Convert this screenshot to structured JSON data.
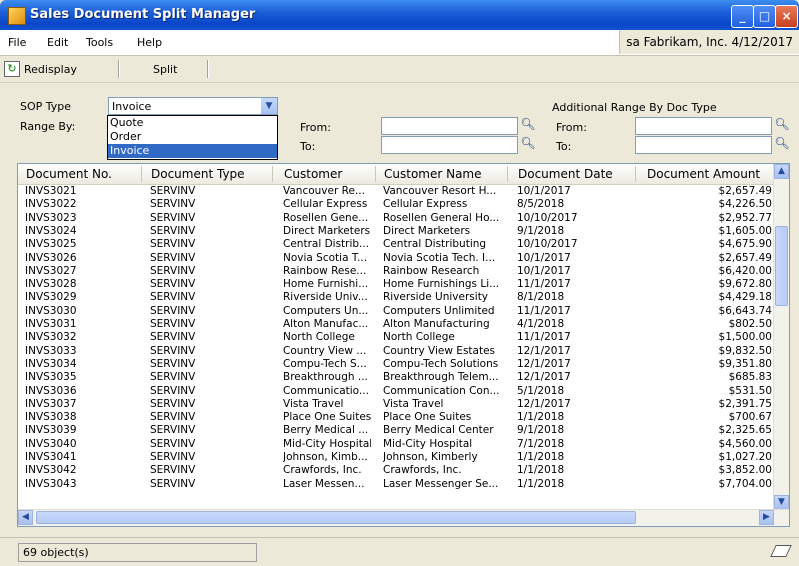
{
  "window": {
    "title": "Sales Document Split Manager"
  },
  "menu": {
    "items": [
      "File",
      "Edit",
      "Tools",
      "Help"
    ],
    "status": "sa  Fabrikam, Inc.  4/12/2017"
  },
  "toolbar": {
    "redisplay_label": "Redisplay",
    "split_label": "Split"
  },
  "filters": {
    "sop_type_label": "SOP Type",
    "sop_type_value": "Invoice",
    "range_by_label": "Range By:",
    "sop_options": [
      "Quote",
      "Order",
      "Invoice"
    ],
    "from_label": "From:",
    "to_label": "To:",
    "additional_label": "Additional Range By Doc Type",
    "from2_label": "From:",
    "to2_label": "To:"
  },
  "grid": {
    "columns": [
      "Document No.",
      "Document Type",
      "Customer",
      "Customer Name",
      "Document Date",
      "Document Amount"
    ],
    "rows": [
      [
        "INVS3021",
        "SERVINV",
        "Vancouver Re...",
        "Vancouver Resort H...",
        "10/1/2017",
        "$2,657.49"
      ],
      [
        "INVS3022",
        "SERVINV",
        "Cellular Express",
        "Cellular Express",
        "8/5/2018",
        "$4,226.50"
      ],
      [
        "INVS3023",
        "SERVINV",
        "Rosellen Gene...",
        "Rosellen General Ho...",
        "10/10/2017",
        "$2,952.77"
      ],
      [
        "INVS3024",
        "SERVINV",
        "Direct Marketers",
        "Direct Marketers",
        "9/1/2018",
        "$1,605.00"
      ],
      [
        "INVS3025",
        "SERVINV",
        "Central Distrib...",
        "Central Distributing",
        "10/10/2017",
        "$4,675.90"
      ],
      [
        "INVS3026",
        "SERVINV",
        "Novia Scotia T...",
        "Novia Scotia Tech. I...",
        "10/1/2017",
        "$2,657.49"
      ],
      [
        "INVS3027",
        "SERVINV",
        "Rainbow Rese...",
        "Rainbow Research",
        "10/1/2017",
        "$6,420.00"
      ],
      [
        "INVS3028",
        "SERVINV",
        "Home Furnishi...",
        "Home Furnishings Li...",
        "11/1/2017",
        "$9,672.80"
      ],
      [
        "INVS3029",
        "SERVINV",
        "Riverside Univ...",
        "Riverside University",
        "8/1/2018",
        "$4,429.18"
      ],
      [
        "INVS3030",
        "SERVINV",
        "Computers Un...",
        "Computers Unlimited",
        "11/1/2017",
        "$6,643.74"
      ],
      [
        "INVS3031",
        "SERVINV",
        "Alton Manufac...",
        "Alton Manufacturing",
        "4/1/2018",
        "$802.50"
      ],
      [
        "INVS3032",
        "SERVINV",
        "North College",
        "North College",
        "11/1/2017",
        "$1,500.00"
      ],
      [
        "INVS3033",
        "SERVINV",
        "Country View ...",
        "Country View Estates",
        "12/1/2017",
        "$9,832.50"
      ],
      [
        "INVS3034",
        "SERVINV",
        "Compu-Tech S...",
        "Compu-Tech Solutions",
        "12/1/2017",
        "$9,351.80"
      ],
      [
        "INVS3035",
        "SERVINV",
        "Breakthrough ...",
        "Breakthrough Telem...",
        "12/1/2017",
        "$685.83"
      ],
      [
        "INVS3036",
        "SERVINV",
        "Communicatio...",
        "Communication Con...",
        "5/1/2018",
        "$531.50"
      ],
      [
        "INVS3037",
        "SERVINV",
        "Vista Travel",
        "Vista Travel",
        "12/1/2017",
        "$2,391.75"
      ],
      [
        "INVS3038",
        "SERVINV",
        "Place One Suites",
        "Place One Suites",
        "1/1/2018",
        "$700.67"
      ],
      [
        "INVS3039",
        "SERVINV",
        "Berry Medical ...",
        "Berry Medical Center",
        "9/1/2018",
        "$2,325.65"
      ],
      [
        "INVS3040",
        "SERVINV",
        "Mid-City Hospital",
        "Mid-City Hospital",
        "7/1/2018",
        "$4,560.00"
      ],
      [
        "INVS3041",
        "SERVINV",
        "Johnson, Kimb...",
        "Johnson, Kimberly",
        "1/1/2018",
        "$1,027.20"
      ],
      [
        "INVS3042",
        "SERVINV",
        "Crawfords, Inc.",
        "Crawfords, Inc.",
        "1/1/2018",
        "$3,852.00"
      ],
      [
        "INVS3043",
        "SERVINV",
        "Laser Messen...",
        "Laser Messenger Se...",
        "1/1/2018",
        "$7,704.00"
      ]
    ]
  },
  "status": {
    "count_text": "69 object(s)"
  }
}
